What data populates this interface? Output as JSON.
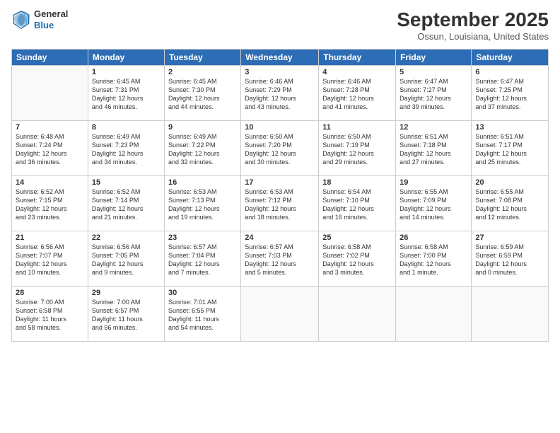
{
  "header": {
    "logo_line1": "General",
    "logo_line2": "Blue",
    "month": "September 2025",
    "location": "Ossun, Louisiana, United States"
  },
  "days_of_week": [
    "Sunday",
    "Monday",
    "Tuesday",
    "Wednesday",
    "Thursday",
    "Friday",
    "Saturday"
  ],
  "weeks": [
    [
      {
        "day": "",
        "info": ""
      },
      {
        "day": "1",
        "info": "Sunrise: 6:45 AM\nSunset: 7:31 PM\nDaylight: 12 hours\nand 46 minutes."
      },
      {
        "day": "2",
        "info": "Sunrise: 6:45 AM\nSunset: 7:30 PM\nDaylight: 12 hours\nand 44 minutes."
      },
      {
        "day": "3",
        "info": "Sunrise: 6:46 AM\nSunset: 7:29 PM\nDaylight: 12 hours\nand 43 minutes."
      },
      {
        "day": "4",
        "info": "Sunrise: 6:46 AM\nSunset: 7:28 PM\nDaylight: 12 hours\nand 41 minutes."
      },
      {
        "day": "5",
        "info": "Sunrise: 6:47 AM\nSunset: 7:27 PM\nDaylight: 12 hours\nand 39 minutes."
      },
      {
        "day": "6",
        "info": "Sunrise: 6:47 AM\nSunset: 7:25 PM\nDaylight: 12 hours\nand 37 minutes."
      }
    ],
    [
      {
        "day": "7",
        "info": "Sunrise: 6:48 AM\nSunset: 7:24 PM\nDaylight: 12 hours\nand 36 minutes."
      },
      {
        "day": "8",
        "info": "Sunrise: 6:49 AM\nSunset: 7:23 PM\nDaylight: 12 hours\nand 34 minutes."
      },
      {
        "day": "9",
        "info": "Sunrise: 6:49 AM\nSunset: 7:22 PM\nDaylight: 12 hours\nand 32 minutes."
      },
      {
        "day": "10",
        "info": "Sunrise: 6:50 AM\nSunset: 7:20 PM\nDaylight: 12 hours\nand 30 minutes."
      },
      {
        "day": "11",
        "info": "Sunrise: 6:50 AM\nSunset: 7:19 PM\nDaylight: 12 hours\nand 29 minutes."
      },
      {
        "day": "12",
        "info": "Sunrise: 6:51 AM\nSunset: 7:18 PM\nDaylight: 12 hours\nand 27 minutes."
      },
      {
        "day": "13",
        "info": "Sunrise: 6:51 AM\nSunset: 7:17 PM\nDaylight: 12 hours\nand 25 minutes."
      }
    ],
    [
      {
        "day": "14",
        "info": "Sunrise: 6:52 AM\nSunset: 7:15 PM\nDaylight: 12 hours\nand 23 minutes."
      },
      {
        "day": "15",
        "info": "Sunrise: 6:52 AM\nSunset: 7:14 PM\nDaylight: 12 hours\nand 21 minutes."
      },
      {
        "day": "16",
        "info": "Sunrise: 6:53 AM\nSunset: 7:13 PM\nDaylight: 12 hours\nand 19 minutes."
      },
      {
        "day": "17",
        "info": "Sunrise: 6:53 AM\nSunset: 7:12 PM\nDaylight: 12 hours\nand 18 minutes."
      },
      {
        "day": "18",
        "info": "Sunrise: 6:54 AM\nSunset: 7:10 PM\nDaylight: 12 hours\nand 16 minutes."
      },
      {
        "day": "19",
        "info": "Sunrise: 6:55 AM\nSunset: 7:09 PM\nDaylight: 12 hours\nand 14 minutes."
      },
      {
        "day": "20",
        "info": "Sunrise: 6:55 AM\nSunset: 7:08 PM\nDaylight: 12 hours\nand 12 minutes."
      }
    ],
    [
      {
        "day": "21",
        "info": "Sunrise: 6:56 AM\nSunset: 7:07 PM\nDaylight: 12 hours\nand 10 minutes."
      },
      {
        "day": "22",
        "info": "Sunrise: 6:56 AM\nSunset: 7:05 PM\nDaylight: 12 hours\nand 9 minutes."
      },
      {
        "day": "23",
        "info": "Sunrise: 6:57 AM\nSunset: 7:04 PM\nDaylight: 12 hours\nand 7 minutes."
      },
      {
        "day": "24",
        "info": "Sunrise: 6:57 AM\nSunset: 7:03 PM\nDaylight: 12 hours\nand 5 minutes."
      },
      {
        "day": "25",
        "info": "Sunrise: 6:58 AM\nSunset: 7:02 PM\nDaylight: 12 hours\nand 3 minutes."
      },
      {
        "day": "26",
        "info": "Sunrise: 6:58 AM\nSunset: 7:00 PM\nDaylight: 12 hours\nand 1 minute."
      },
      {
        "day": "27",
        "info": "Sunrise: 6:59 AM\nSunset: 6:59 PM\nDaylight: 12 hours\nand 0 minutes."
      }
    ],
    [
      {
        "day": "28",
        "info": "Sunrise: 7:00 AM\nSunset: 6:58 PM\nDaylight: 11 hours\nand 58 minutes."
      },
      {
        "day": "29",
        "info": "Sunrise: 7:00 AM\nSunset: 6:57 PM\nDaylight: 11 hours\nand 56 minutes."
      },
      {
        "day": "30",
        "info": "Sunrise: 7:01 AM\nSunset: 6:55 PM\nDaylight: 11 hours\nand 54 minutes."
      },
      {
        "day": "",
        "info": ""
      },
      {
        "day": "",
        "info": ""
      },
      {
        "day": "",
        "info": ""
      },
      {
        "day": "",
        "info": ""
      }
    ]
  ]
}
